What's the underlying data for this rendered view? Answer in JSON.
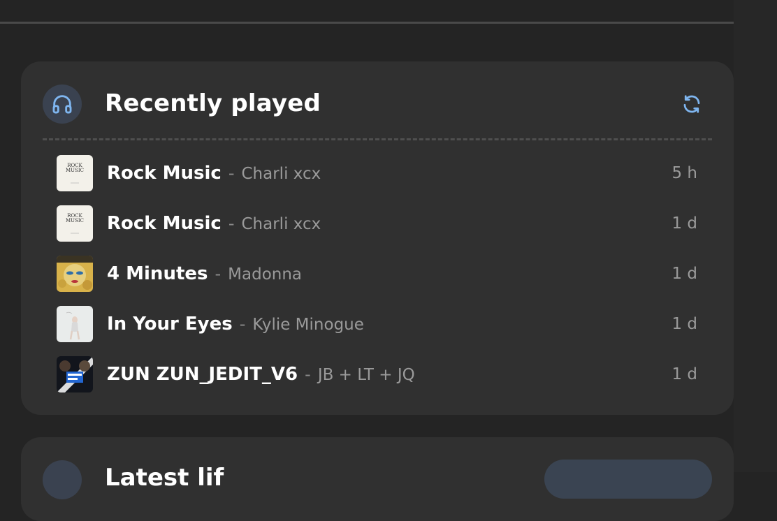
{
  "recently_played": {
    "title": "Recently played",
    "icon": "headphones-icon",
    "refresh_icon": "refresh-icon",
    "accent_color": "#7fb6f0",
    "tracks": [
      {
        "title": "Rock Music",
        "separator": "-",
        "artist": "Charli xcx",
        "time": "5 h",
        "art": "rock-music-album-art"
      },
      {
        "title": "Rock Music",
        "separator": "-",
        "artist": "Charli xcx",
        "time": "1 d",
        "art": "rock-music-album-art"
      },
      {
        "title": "4 Minutes",
        "separator": "-",
        "artist": "Madonna",
        "time": "1 d",
        "art": "celebration-album-art"
      },
      {
        "title": "In Your Eyes",
        "separator": "-",
        "artist": "Kylie Minogue",
        "time": "1 d",
        "art": "fever-album-art"
      },
      {
        "title": "ZUN ZUN_JEDIT_V6",
        "separator": "-",
        "artist": "JB + LT + JQ",
        "time": "1 d",
        "art": "zun-zun-album-art"
      }
    ],
    "rock_art_text": "ROCK MUSIC"
  },
  "next_card": {
    "title": "Latest lif"
  }
}
